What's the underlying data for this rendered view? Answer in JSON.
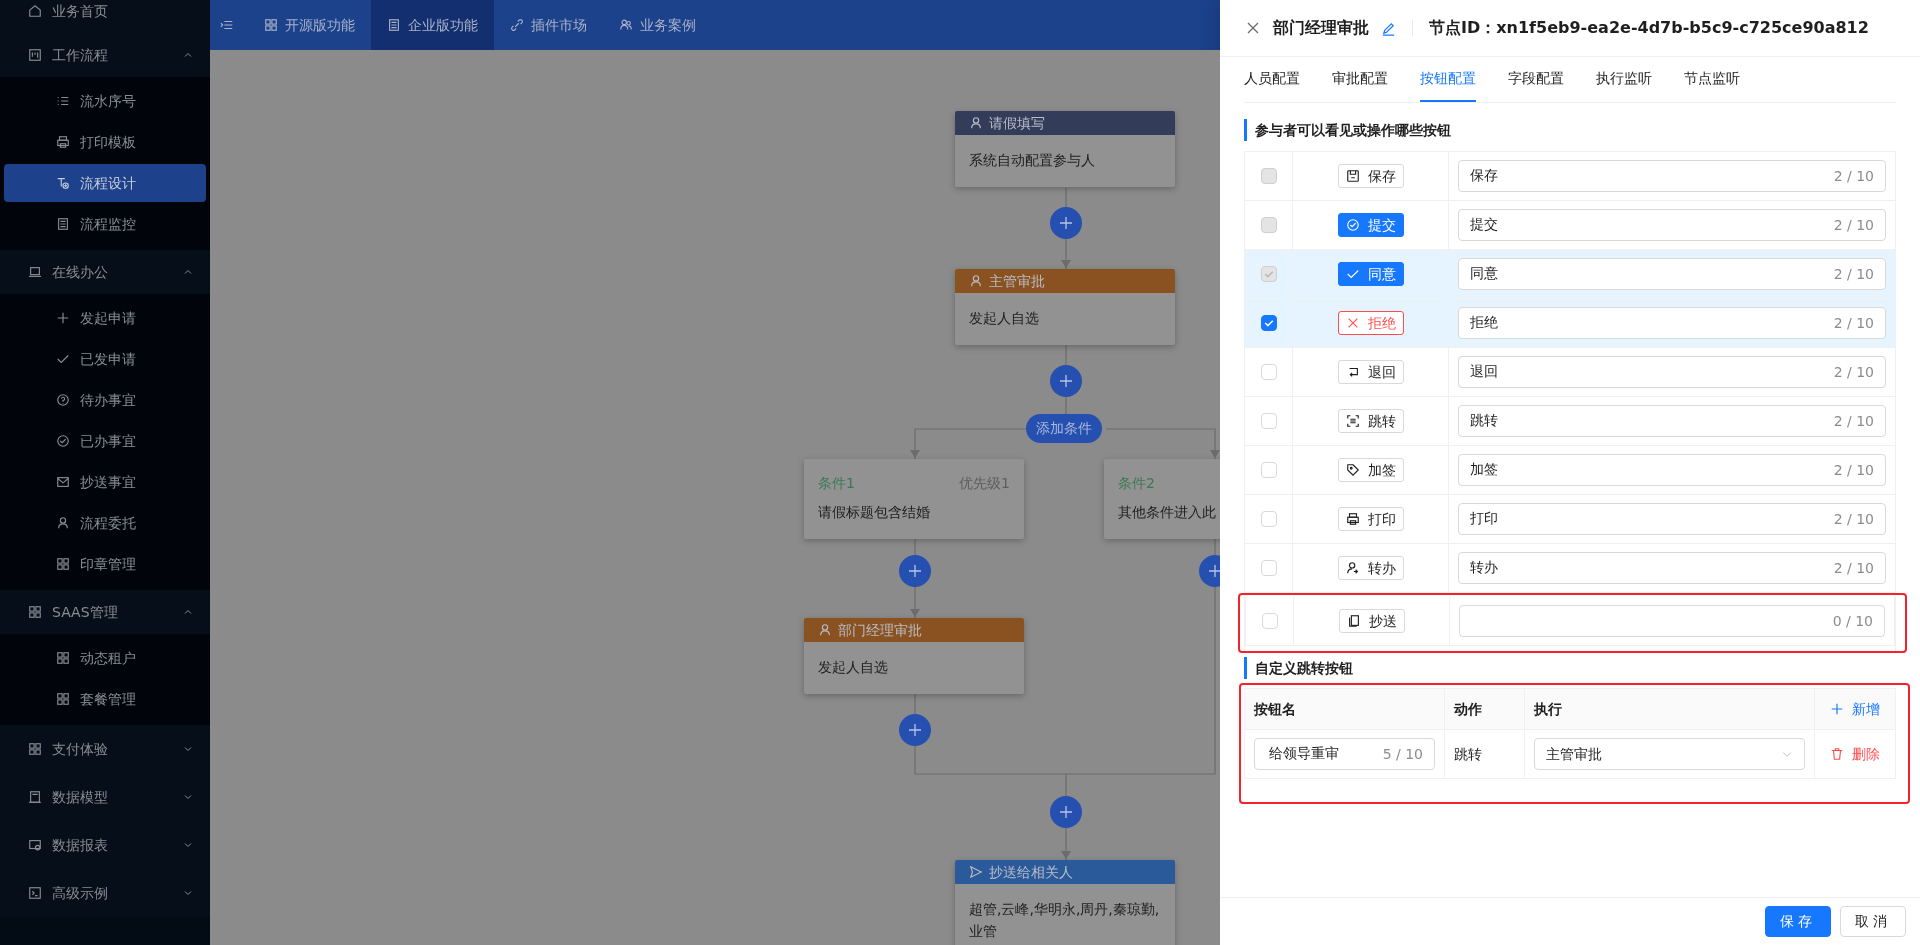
{
  "sidebar": {
    "items": [
      {
        "label": "业务首页"
      },
      {
        "label": "工作流程",
        "expanded": true,
        "children": [
          {
            "label": "流水序号",
            "selected": false
          },
          {
            "label": "打印模板",
            "selected": false
          },
          {
            "label": "流程设计",
            "selected": true
          },
          {
            "label": "流程监控",
            "selected": false
          }
        ]
      },
      {
        "label": "在线办公",
        "expanded": true,
        "children": [
          {
            "label": "发起申请",
            "selected": false
          },
          {
            "label": "已发申请",
            "selected": false
          },
          {
            "label": "待办事宜",
            "selected": false
          },
          {
            "label": "已办事宜",
            "selected": false
          },
          {
            "label": "抄送事宜",
            "selected": false
          },
          {
            "label": "流程委托",
            "selected": false
          },
          {
            "label": "印章管理",
            "selected": false
          }
        ]
      },
      {
        "label": "SAAS管理",
        "expanded": true,
        "children": [
          {
            "label": "动态租户",
            "selected": false
          },
          {
            "label": "套餐管理",
            "selected": false
          }
        ]
      },
      {
        "label": "支付体验",
        "expanded": false
      },
      {
        "label": "数据模型",
        "expanded": false
      },
      {
        "label": "数据报表",
        "expanded": false
      },
      {
        "label": "高级示例",
        "expanded": false
      }
    ]
  },
  "top_nav": {
    "tabs": [
      {
        "label": "开源版功能",
        "selected": false
      },
      {
        "label": "企业版功能",
        "selected": true
      },
      {
        "label": "插件市场",
        "selected": false
      },
      {
        "label": "业务案例",
        "selected": false
      }
    ]
  },
  "flow": {
    "nodes": [
      {
        "kind": "task",
        "title": "请假填写",
        "color": "#333d5a",
        "body": "系统自动配置参与人"
      },
      {
        "kind": "task",
        "title": "主管审批",
        "color": "#8a5220",
        "body": "发起人自选"
      },
      {
        "kind": "add_condition",
        "label": "添加条件"
      },
      {
        "kind": "condition",
        "title": "条件1",
        "priority": "优先级1",
        "body": "请假标题包含结婚"
      },
      {
        "kind": "condition",
        "title": "条件2",
        "body": "其他条件进入此"
      },
      {
        "kind": "task",
        "title": "部门经理审批",
        "color": "#8a5220",
        "body": "发起人自选"
      },
      {
        "kind": "cc",
        "title": "抄送给相关人",
        "color": "#2a5a9a",
        "body": "超管,云峰,华明永,周丹,秦琼勤,业管"
      }
    ]
  },
  "drawer": {
    "title": "部门经理审批",
    "node_id": "节点ID：xn1f5eb9-ea2e-4d7b-b5c9-c725ce90a812",
    "tabs": [
      {
        "label": "人员配置",
        "selected": false
      },
      {
        "label": "审批配置",
        "selected": false
      },
      {
        "label": "按钮配置",
        "selected": true
      },
      {
        "label": "字段配置",
        "selected": false
      },
      {
        "label": "执行监听",
        "selected": false
      },
      {
        "label": "节点监听",
        "selected": false
      }
    ],
    "buttons_section": {
      "title": "参与者可以看见或操作哪些按钮",
      "rows": [
        {
          "checked": false,
          "disabled": true,
          "button": "保存",
          "kind": "default",
          "value": "保存",
          "count": "2 / 10",
          "annotated": false
        },
        {
          "checked": false,
          "disabled": true,
          "button": "提交",
          "kind": "primary",
          "value": "提交",
          "count": "2 / 10",
          "annotated": false
        },
        {
          "checked": true,
          "disabled": true,
          "button": "同意",
          "kind": "primary",
          "value": "同意",
          "count": "2 / 10",
          "annotated": false
        },
        {
          "checked": true,
          "disabled": false,
          "button": "拒绝",
          "kind": "danger",
          "value": "拒绝",
          "count": "2 / 10",
          "annotated": false
        },
        {
          "checked": false,
          "disabled": false,
          "button": "退回",
          "kind": "default",
          "value": "退回",
          "count": "2 / 10",
          "annotated": false
        },
        {
          "checked": false,
          "disabled": false,
          "button": "跳转",
          "kind": "default",
          "value": "跳转",
          "count": "2 / 10",
          "annotated": false
        },
        {
          "checked": false,
          "disabled": false,
          "button": "加签",
          "kind": "default",
          "value": "加签",
          "count": "2 / 10",
          "annotated": false
        },
        {
          "checked": false,
          "disabled": false,
          "button": "打印",
          "kind": "default",
          "value": "打印",
          "count": "2 / 10",
          "annotated": false
        },
        {
          "checked": false,
          "disabled": false,
          "button": "转办",
          "kind": "default",
          "value": "转办",
          "count": "2 / 10",
          "annotated": false
        },
        {
          "checked": false,
          "disabled": false,
          "button": "抄送",
          "kind": "default",
          "count": "0 / 10",
          "annotated": true
        }
      ]
    },
    "custom_section": {
      "title": "自定义跳转按钮",
      "annotated": true,
      "columns": [
        "按钮名",
        "动作",
        "执行"
      ],
      "add": "新增",
      "rows": [
        {
          "name": "给领导重审",
          "count": "5 / 10",
          "action": "跳转",
          "target": "主管审批",
          "delete": "删除"
        }
      ]
    },
    "footer": {
      "save": "保存",
      "cancel": "取消"
    }
  }
}
